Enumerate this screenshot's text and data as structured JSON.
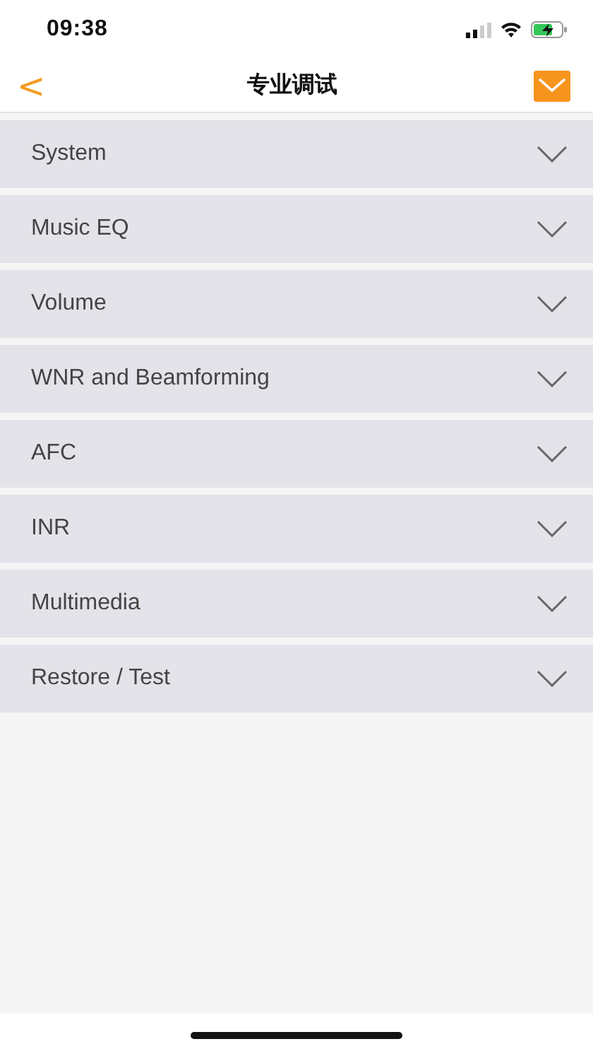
{
  "status_bar": {
    "time": "09:38"
  },
  "nav_bar": {
    "back": "<",
    "title": "专业调试"
  },
  "sections": [
    {
      "label": "System",
      "expanded": false
    },
    {
      "label": "Music EQ",
      "expanded": false
    },
    {
      "label": "Volume",
      "expanded": false
    },
    {
      "label": "WNR and Beamforming",
      "expanded": false
    },
    {
      "label": "AFC",
      "expanded": false
    },
    {
      "label": "INR",
      "expanded": false
    },
    {
      "label": "Multimedia",
      "expanded": false
    },
    {
      "label": "Restore / Test",
      "expanded": false
    }
  ]
}
